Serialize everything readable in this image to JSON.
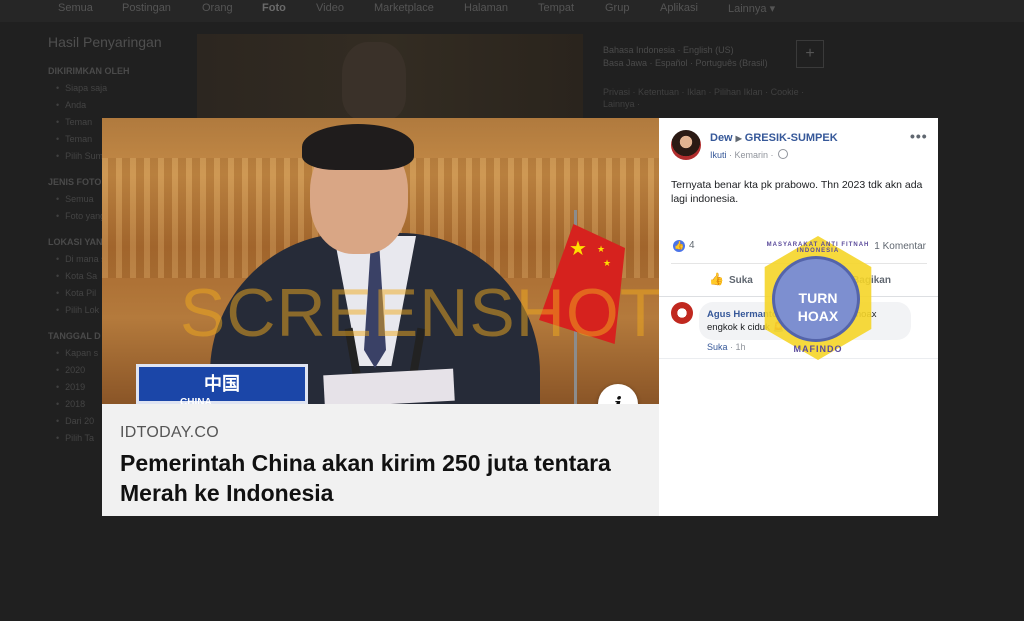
{
  "background": {
    "nav_tabs": [
      "Semua",
      "Postingan",
      "Orang",
      "Foto",
      "Video",
      "Marketplace",
      "Halaman",
      "Tempat",
      "Grup",
      "Aplikasi",
      "Lainnya ▾"
    ],
    "sidebar_title": "Hasil Penyaringan",
    "sections": [
      {
        "title": "DIKIRIMKAN OLEH",
        "items": [
          "Siapa saja",
          "Anda",
          "Teman",
          "Teman",
          "Pilih Sumber"
        ]
      },
      {
        "title": "JENIS FOTO",
        "items": [
          "Semua",
          "Foto yang"
        ]
      },
      {
        "title": "LOKASI YANG",
        "items": [
          "Di mana saja",
          "Kota Sa",
          "Kota Pil",
          "Pilih Lok"
        ]
      },
      {
        "title": "TANGGAL D",
        "items": [
          "Kapan s",
          "2020",
          "2019",
          "2018",
          "Dari 20",
          "Pilih Ta"
        ]
      }
    ],
    "right_lang_1": "Bahasa Indonesia · English (US)",
    "right_lang_2": "Basa Jawa · Español · Português (Brasil)",
    "right_footer": "Privasi · Ketentuan · Iklan · Pilihan Iklan · Cookie · Lainnya ·"
  },
  "photo": {
    "nameplate": "中国",
    "nameplate_sub": "CHINA",
    "watermark": "SCREENSHOT BY",
    "info_icon": "i",
    "source": "IDTODAY.CO",
    "headline": "Pemerintah China akan kirim 250 juta tentara Merah ke Indonesia"
  },
  "post": {
    "author": "Dew",
    "group": "GRESIK-SUMPEK",
    "follow": "Ikuti",
    "time": "Kemarin",
    "text": "Ternyata benar kta pk prabowo. Thn 2023 tdk akn ada lagi indonesia.",
    "likes": "4",
    "comments": "1 Komentar",
    "like_action": "Suka",
    "share_action": "Bagikan",
    "comment": {
      "name": "Agus Hermanto",
      "text": "Ojo nyebar berita hoax engkok k ciduk 🚨",
      "like": "Suka",
      "time": "1h"
    }
  },
  "stamp": {
    "arc_text": "MASYARAKAT ANTI FITNAH INDONESIA",
    "line1": "TURN",
    "line2": "HOAX",
    "bottom": "MAFINDO"
  }
}
